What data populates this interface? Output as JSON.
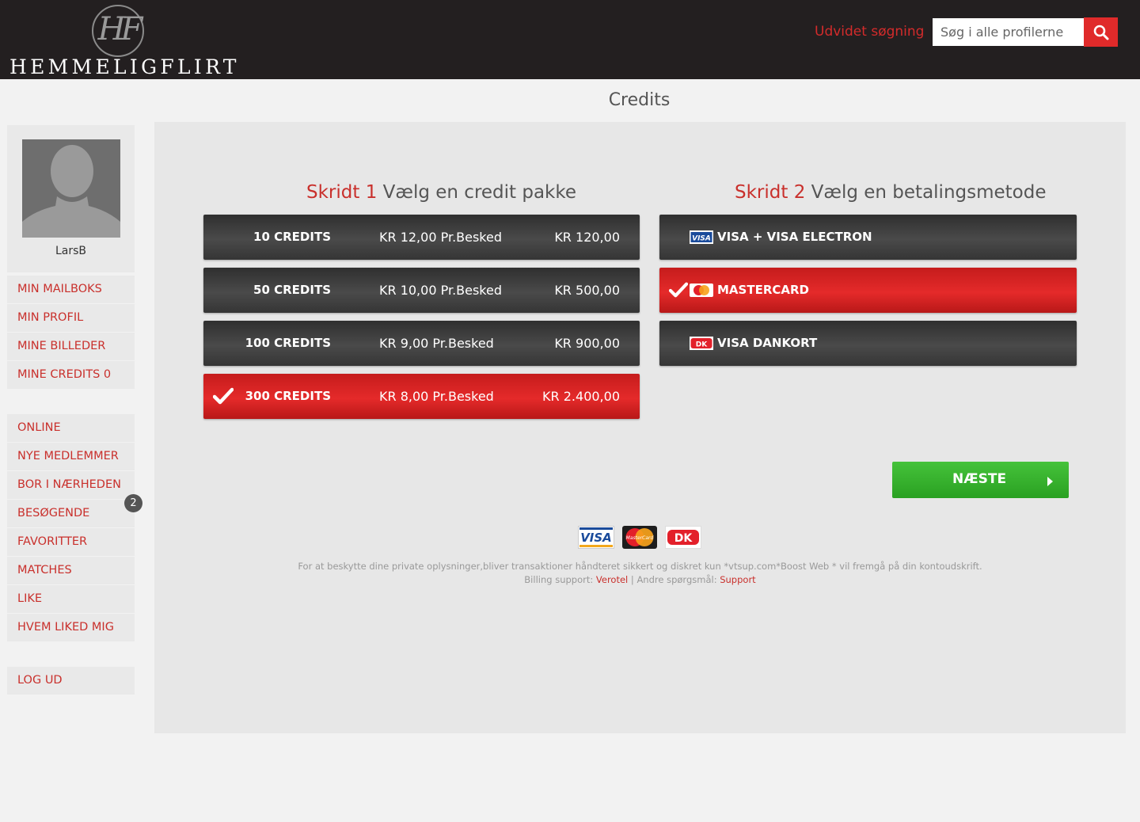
{
  "header": {
    "logo_monogram": "HF",
    "logo_text": "HEMMELIGFLIRT",
    "advanced_search": "Udvidet søgning",
    "search_placeholder": "Søg i alle profilerne"
  },
  "page_title": "Credits",
  "sidebar": {
    "username": "LarsB",
    "menu1": [
      "MIN MAILBOKS",
      "MIN PROFIL",
      "MINE BILLEDER",
      "MINE CREDITS 0"
    ],
    "menu2": [
      "ONLINE",
      "NYE MEDLEMMER",
      "BOR I NÆRHEDEN",
      "BESØGENDE",
      "FAVORITTER",
      "MATCHES",
      "LIKE",
      "HVEM LIKED MIG"
    ],
    "visitors_badge": "2",
    "logout": "LOG UD"
  },
  "step1": {
    "num": "Skridt 1",
    "text": "Vælg en credit pakke"
  },
  "step2": {
    "num": "Skridt 2",
    "text": "Vælg en betalingsmetode"
  },
  "packages": [
    {
      "credits": "10 CREDITS",
      "per": "KR 12,00 Pr.Besked",
      "price": "KR 120,00",
      "selected": false
    },
    {
      "credits": "50 CREDITS",
      "per": "KR 10,00 Pr.Besked",
      "price": "KR 500,00",
      "selected": false
    },
    {
      "credits": "100 CREDITS",
      "per": "KR 9,00 Pr.Besked",
      "price": "KR 900,00",
      "selected": false
    },
    {
      "credits": "300 CREDITS",
      "per": "KR 8,00 Pr.Besked",
      "price": "KR 2.400,00",
      "selected": true
    }
  ],
  "payment_methods": [
    {
      "label": "VISA + VISA ELECTRON",
      "icon": "visa-icon",
      "selected": false
    },
    {
      "label": "MASTERCARD",
      "icon": "mastercard-icon",
      "selected": true
    },
    {
      "label": "VISA DANKORT",
      "icon": "dankort-icon",
      "selected": false
    }
  ],
  "next_button": "NÆSTE",
  "card_logos": {
    "visa": "VISA",
    "mastercard": "MasterCard",
    "dankort": "DK"
  },
  "disclaimer": {
    "line1": "For at beskytte dine private oplysninger,bliver transaktioner håndteret sikkert og diskret kun *vtsup.com*Boost Web * vil fremgå på din kontoudskrift.",
    "billing_label": "Billing support:",
    "billing_link": "Verotel",
    "separator": "|",
    "other_label": "Andre spørgsmål:",
    "other_link": "Support"
  },
  "colors": {
    "accent_red": "#e02a2a",
    "header_bg": "#231f20",
    "next_green": "#37b12d"
  }
}
